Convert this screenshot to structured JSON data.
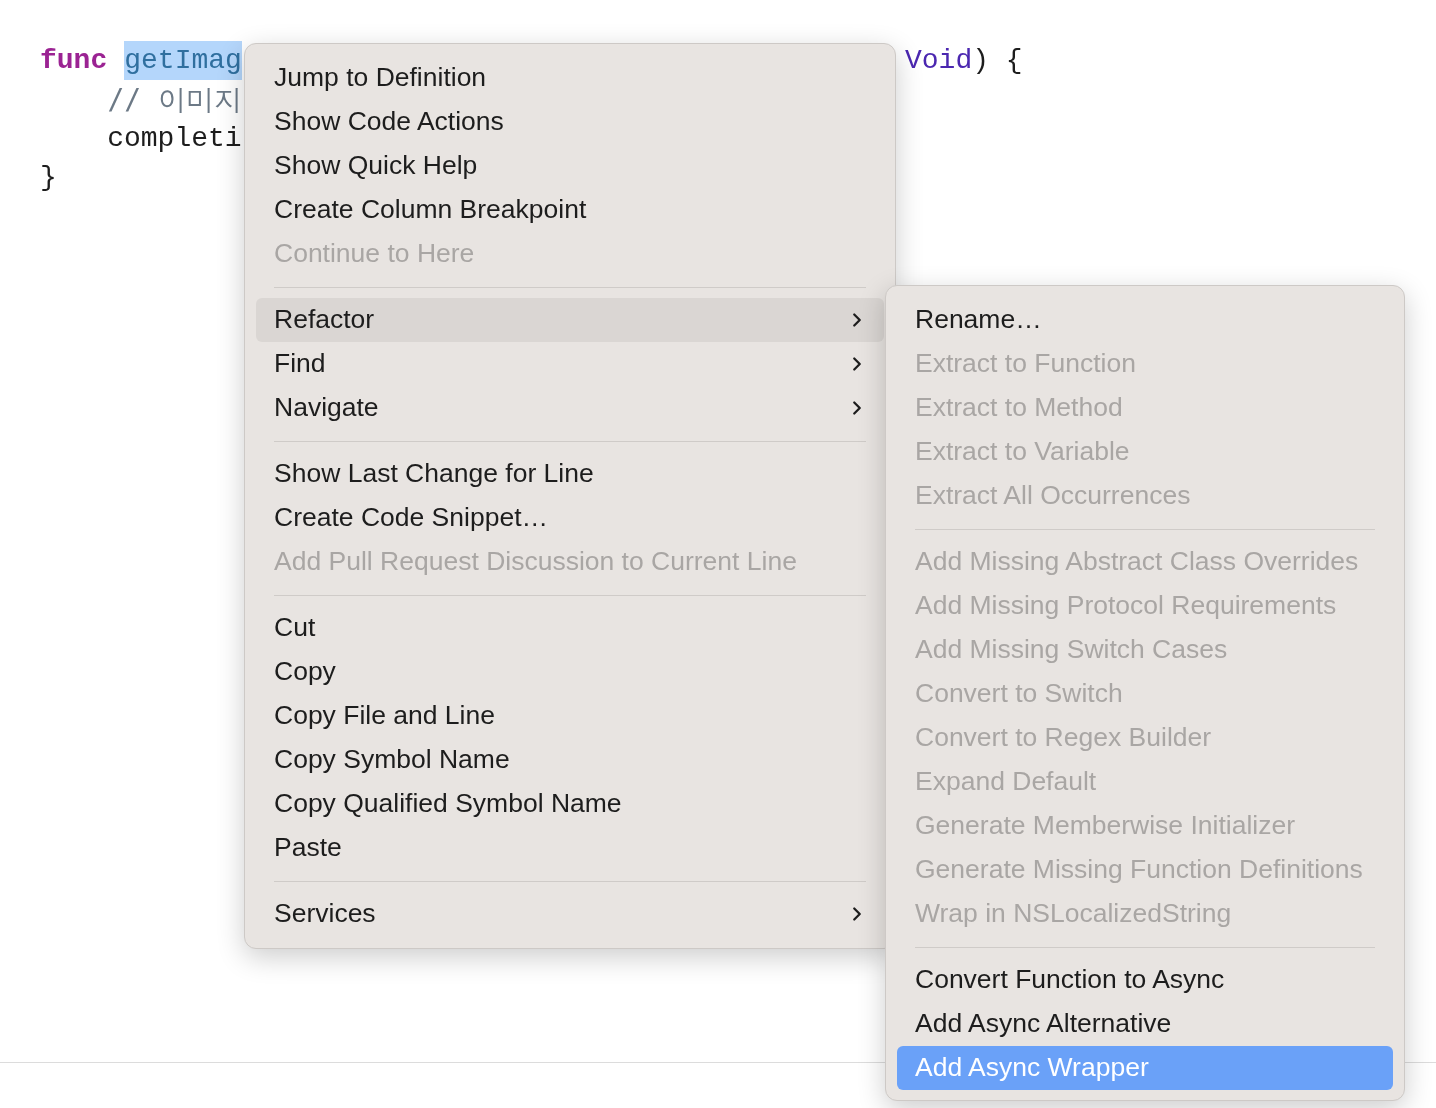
{
  "code": {
    "lines": [
      {
        "segments": [
          {
            "text": "func",
            "kind": "keyword"
          },
          {
            "text": "getImag",
            "kind": "selection"
          }
        ],
        "tail": [
          {
            "text": "Void",
            "kind": "type"
          },
          {
            "text": ") {",
            "kind": "plain"
          }
        ]
      },
      {
        "segments": [
          {
            "text": "    // 이미지",
            "kind": "comment"
          }
        ]
      },
      {
        "segments": [
          {
            "text": "    completi",
            "kind": "plain"
          }
        ]
      },
      {
        "segments": [
          {
            "text": "}",
            "kind": "plain"
          }
        ]
      }
    ]
  },
  "context_menu": {
    "items": [
      {
        "kind": "item",
        "label": "Jump to Definition",
        "disabled": false,
        "selected": false,
        "submenu": false
      },
      {
        "kind": "item",
        "label": "Show Code Actions",
        "disabled": false,
        "selected": false,
        "submenu": false
      },
      {
        "kind": "item",
        "label": "Show Quick Help",
        "disabled": false,
        "selected": false,
        "submenu": false
      },
      {
        "kind": "item",
        "label": "Create Column Breakpoint",
        "disabled": false,
        "selected": false,
        "submenu": false
      },
      {
        "kind": "item",
        "label": "Continue to Here",
        "disabled": true,
        "selected": false,
        "submenu": false
      },
      {
        "kind": "separator"
      },
      {
        "kind": "item",
        "label": "Refactor",
        "disabled": false,
        "selected": true,
        "submenu": true
      },
      {
        "kind": "item",
        "label": "Find",
        "disabled": false,
        "selected": false,
        "submenu": true
      },
      {
        "kind": "item",
        "label": "Navigate",
        "disabled": false,
        "selected": false,
        "submenu": true
      },
      {
        "kind": "separator"
      },
      {
        "kind": "item",
        "label": "Show Last Change for Line",
        "disabled": false,
        "selected": false,
        "submenu": false
      },
      {
        "kind": "item",
        "label": "Create Code Snippet…",
        "disabled": false,
        "selected": false,
        "submenu": false
      },
      {
        "kind": "item",
        "label": "Add Pull Request Discussion to Current Line",
        "disabled": true,
        "selected": false,
        "submenu": false
      },
      {
        "kind": "separator"
      },
      {
        "kind": "item",
        "label": "Cut",
        "disabled": false,
        "selected": false,
        "submenu": false
      },
      {
        "kind": "item",
        "label": "Copy",
        "disabled": false,
        "selected": false,
        "submenu": false
      },
      {
        "kind": "item",
        "label": "Copy File and Line",
        "disabled": false,
        "selected": false,
        "submenu": false
      },
      {
        "kind": "item",
        "label": "Copy Symbol Name",
        "disabled": false,
        "selected": false,
        "submenu": false
      },
      {
        "kind": "item",
        "label": "Copy Qualified Symbol Name",
        "disabled": false,
        "selected": false,
        "submenu": false
      },
      {
        "kind": "item",
        "label": "Paste",
        "disabled": false,
        "selected": false,
        "submenu": false
      },
      {
        "kind": "separator"
      },
      {
        "kind": "item",
        "label": "Services",
        "disabled": false,
        "selected": false,
        "submenu": true
      }
    ]
  },
  "refactor_submenu": {
    "items": [
      {
        "kind": "item",
        "label": "Rename…",
        "disabled": false,
        "selected": false
      },
      {
        "kind": "item",
        "label": "Extract to Function",
        "disabled": true,
        "selected": false
      },
      {
        "kind": "item",
        "label": "Extract to Method",
        "disabled": true,
        "selected": false
      },
      {
        "kind": "item",
        "label": "Extract to Variable",
        "disabled": true,
        "selected": false
      },
      {
        "kind": "item",
        "label": "Extract All Occurrences",
        "disabled": true,
        "selected": false
      },
      {
        "kind": "separator"
      },
      {
        "kind": "item",
        "label": "Add Missing Abstract Class Overrides",
        "disabled": true,
        "selected": false
      },
      {
        "kind": "item",
        "label": "Add Missing Protocol Requirements",
        "disabled": true,
        "selected": false
      },
      {
        "kind": "item",
        "label": "Add Missing Switch Cases",
        "disabled": true,
        "selected": false
      },
      {
        "kind": "item",
        "label": "Convert to Switch",
        "disabled": true,
        "selected": false
      },
      {
        "kind": "item",
        "label": "Convert to Regex Builder",
        "disabled": true,
        "selected": false
      },
      {
        "kind": "item",
        "label": "Expand Default",
        "disabled": true,
        "selected": false
      },
      {
        "kind": "item",
        "label": "Generate Memberwise Initializer",
        "disabled": true,
        "selected": false
      },
      {
        "kind": "item",
        "label": "Generate Missing Function Definitions",
        "disabled": true,
        "selected": false
      },
      {
        "kind": "item",
        "label": "Wrap in NSLocalizedString",
        "disabled": true,
        "selected": false
      },
      {
        "kind": "separator"
      },
      {
        "kind": "item",
        "label": "Convert Function to Async",
        "disabled": false,
        "selected": false
      },
      {
        "kind": "item",
        "label": "Add Async Alternative",
        "disabled": false,
        "selected": false
      },
      {
        "kind": "item",
        "label": "Add Async Wrapper",
        "disabled": false,
        "selected": true
      }
    ]
  }
}
